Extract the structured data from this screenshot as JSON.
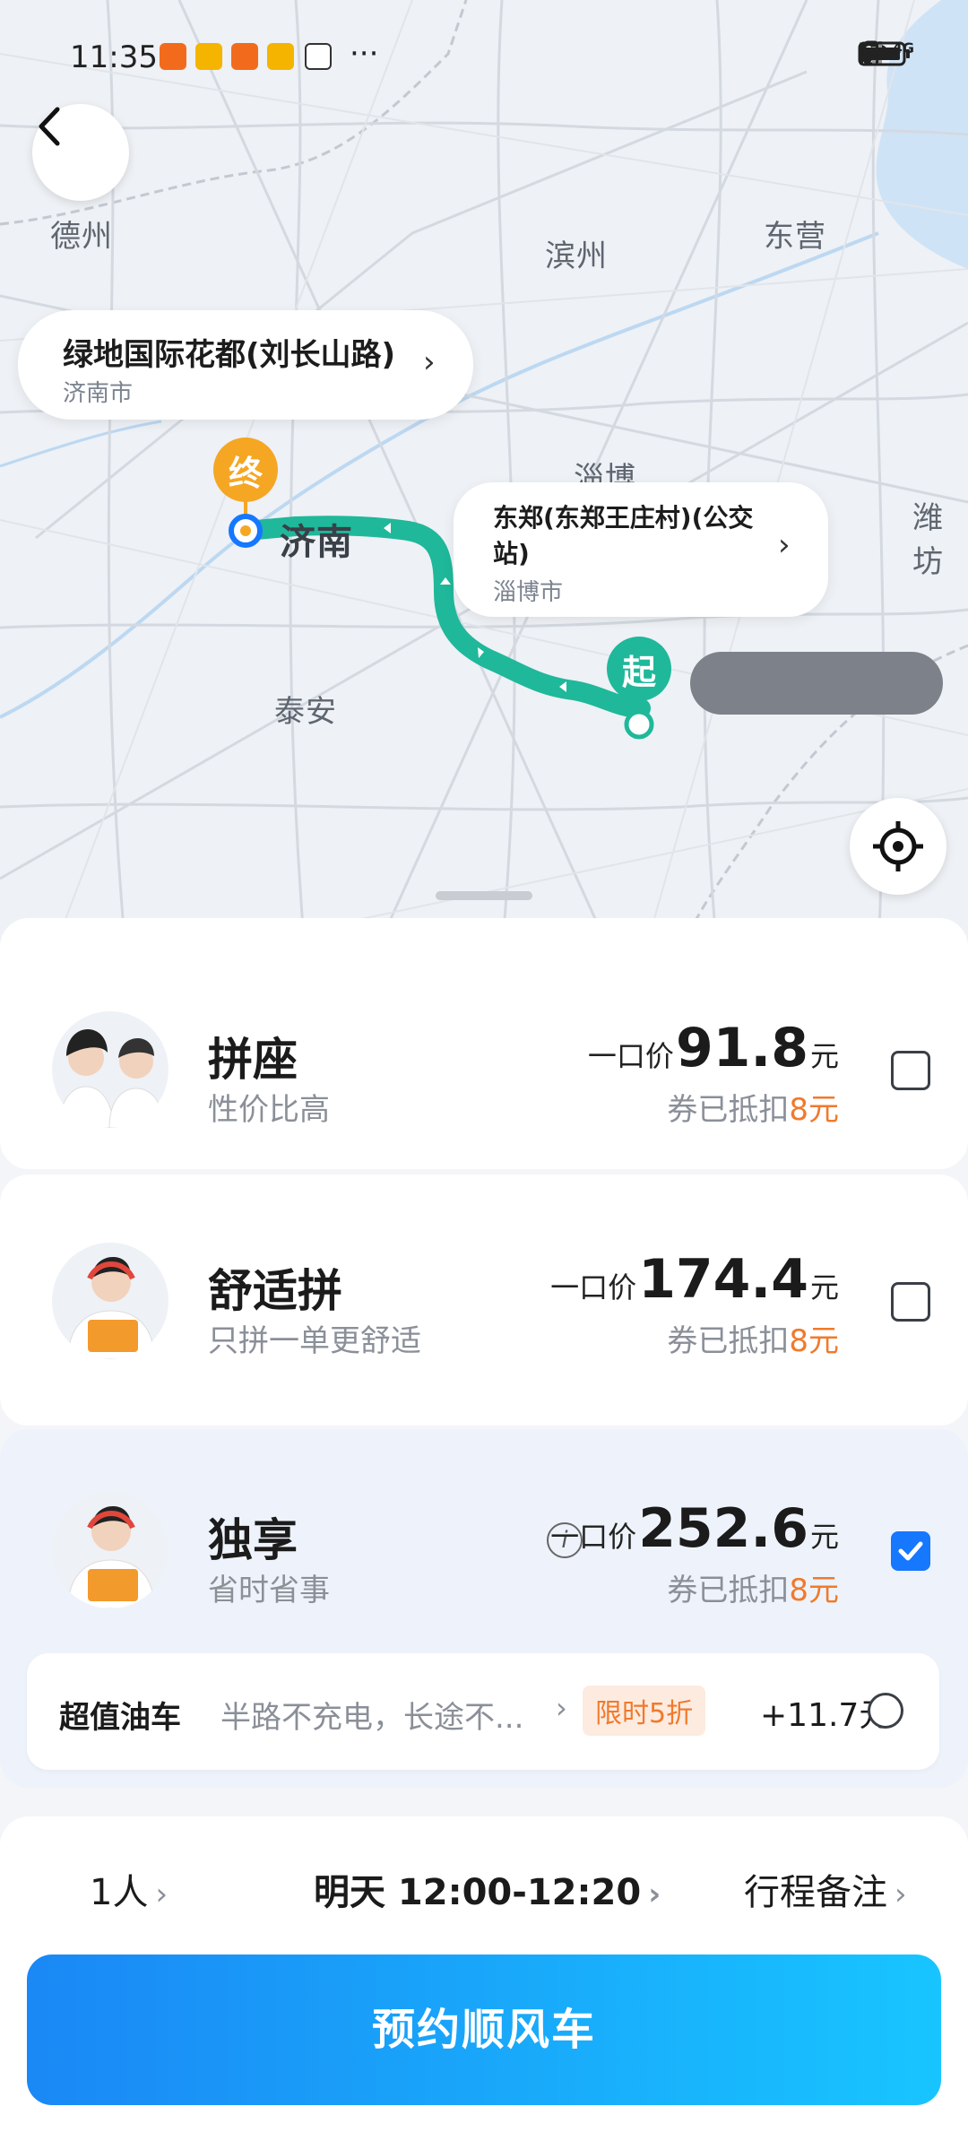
{
  "status_bar": {
    "time": "11:35",
    "dots": "···",
    "network": "5G",
    "network2": "4G",
    "app_icons": [
      "taobao-icon",
      "weibo-icon",
      "taobao-icon",
      "weibo-icon",
      "wechat-icon"
    ]
  },
  "map": {
    "cities": [
      "德州",
      "滨州",
      "东营",
      "淄博",
      "济南",
      "潍坊",
      "泰安"
    ],
    "end_marker": "终",
    "start_marker": "起",
    "route_color": "#1fb89a",
    "destination": {
      "title": "绿地国际花都(刘长山路)",
      "city": "济南市"
    },
    "origin": {
      "title_line1": "东郑(东郑王庄村)(公交",
      "title_line2": "站)",
      "city": "淄博市"
    }
  },
  "options": [
    {
      "title": "拼座",
      "subtitle": "性价比高",
      "price_prefix": "一口价",
      "price": "91.8",
      "unit": "元",
      "coupon_text": "券已抵扣",
      "coupon_amount": "8元",
      "selected": false
    },
    {
      "title": "舒适拼",
      "subtitle": "只拼一单更舒适",
      "price_prefix": "一口价",
      "price": "174.4",
      "unit": "元",
      "coupon_text": "券已抵扣",
      "coupon_amount": "8元",
      "selected": false
    },
    {
      "title": "独享",
      "subtitle": "省时省事",
      "price_prefix": "一口价",
      "price": "252.6",
      "unit": "元",
      "coupon_text": "券已抵扣",
      "coupon_amount": "8元",
      "selected": true
    }
  ],
  "addon": {
    "name": "超值油车",
    "description": "半路不充电，长途不...",
    "tag": "限时5折",
    "price": "+11.7元"
  },
  "trip": {
    "passengers": "1人",
    "time": "明天 12:00-12:20",
    "notes": "行程备注"
  },
  "cta_label": "预约顺风车",
  "colors": {
    "accent": "#1677ff",
    "coupon": "#f07a2c",
    "marker_end": "#f5a623",
    "marker_start": "#1fb89a"
  }
}
